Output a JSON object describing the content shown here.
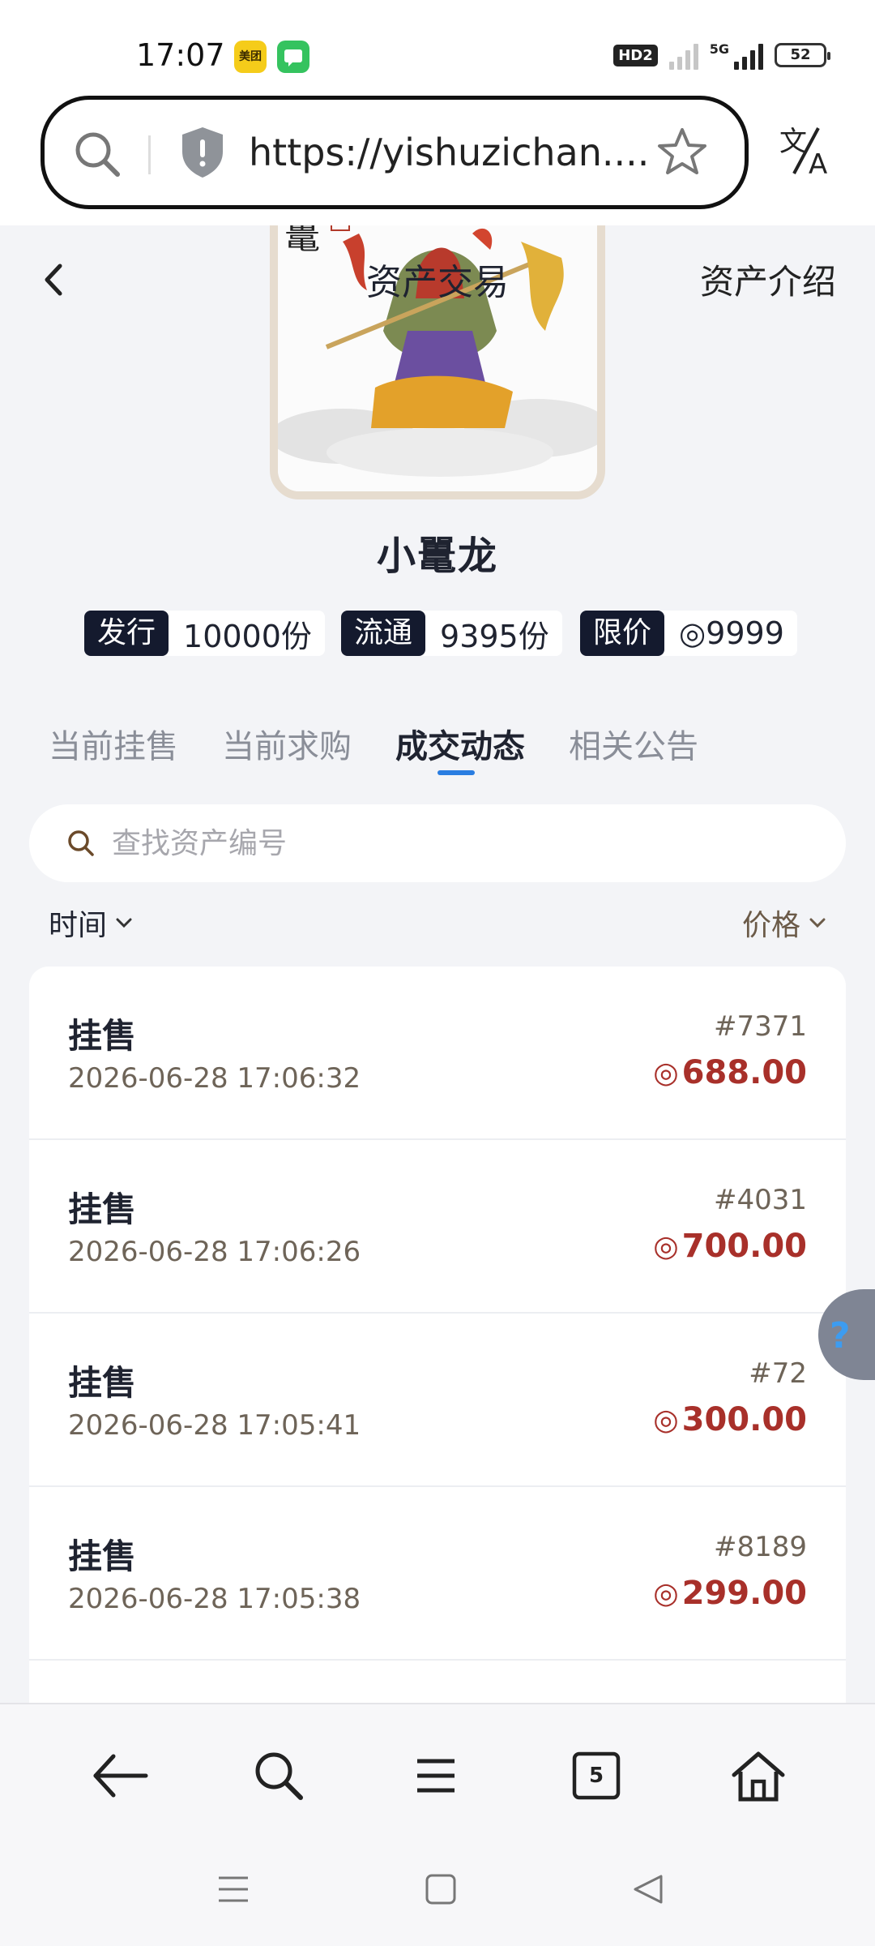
{
  "status_bar": {
    "time": "17:07",
    "apps": [
      "美团"
    ],
    "battery": "52",
    "hd": "HD2",
    "net": "5G"
  },
  "browser": {
    "url": "https://yishuzichan...."
  },
  "page": {
    "title": "资产交易",
    "asset_intro": "资产介绍",
    "asset_name": "小鼍龙"
  },
  "stats": [
    {
      "label": "发行",
      "value": "10000份"
    },
    {
      "label": "流通",
      "value": "9395份"
    },
    {
      "label": "限价",
      "value": "◎9999"
    }
  ],
  "tabs": [
    {
      "label": "当前挂售",
      "active": false
    },
    {
      "label": "当前求购",
      "active": false
    },
    {
      "label": "成交动态",
      "active": true
    },
    {
      "label": "相关公告",
      "active": false
    }
  ],
  "search": {
    "placeholder": "查找资产编号"
  },
  "sort": {
    "time_label": "时间",
    "price_label": "价格"
  },
  "records": [
    {
      "type": "挂售",
      "time": "2026-06-28 17:06:32",
      "id": "#7371",
      "price": "688.00"
    },
    {
      "type": "挂售",
      "time": "2026-06-28 17:06:26",
      "id": "#4031",
      "price": "700.00"
    },
    {
      "type": "挂售",
      "time": "2026-06-28 17:05:41",
      "id": "#72",
      "price": "300.00"
    },
    {
      "type": "挂售",
      "time": "2026-06-28 17:05:38",
      "id": "#8189",
      "price": "299.00"
    }
  ],
  "bottom_nav": {
    "tab_count": "5"
  },
  "colors": {
    "accent": "#2a7de1",
    "price": "#a8302a",
    "label_bg": "#141a2e"
  }
}
